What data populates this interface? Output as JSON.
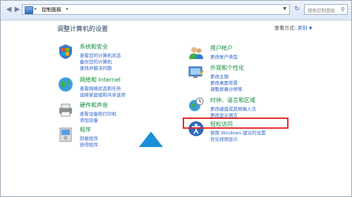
{
  "address_bar": {
    "crumb": "控制面板",
    "search_placeholder": "搜索控制面板"
  },
  "page_title": "调整计算机的设置",
  "view_by": {
    "label": "查看方式:",
    "value": "类别"
  },
  "categories_left": [
    {
      "title": "系统和安全",
      "links": [
        "查看您的计算机状态",
        "备份您的计算机",
        "查找并解决问题"
      ],
      "icon": "shield-flag-icon"
    },
    {
      "title": "网络和 Internet",
      "links": [
        "查看网络状态和任务",
        "选择家庭组和共享选项"
      ],
      "icon": "globe-network-icon"
    },
    {
      "title": "硬件和声音",
      "links": [
        "查看设备和打印机",
        "添加设备"
      ],
      "icon": "printer-icon"
    },
    {
      "title": "程序",
      "links": [
        "卸载程序",
        "获得程序"
      ],
      "icon": "programs-icon"
    }
  ],
  "categories_right": [
    {
      "title": "用户帐户",
      "links": [
        "更改帐户类型"
      ],
      "icon": "users-icon"
    },
    {
      "title": "外观和个性化",
      "links": [
        "更改主题",
        "更改桌面背景",
        "调整屏幕分辨率"
      ],
      "icon": "appearance-icon"
    },
    {
      "title": "时钟、语言和区域",
      "links": [
        "更改键盘或其他输入法",
        "更改显示语言"
      ],
      "icon": "clock-globe-icon"
    },
    {
      "title": "轻松访问",
      "links": [
        "使用 Windows 建议的设置",
        "优化视频显示"
      ],
      "icon": "ease-of-access-icon"
    }
  ],
  "colors": {
    "category_title": "#0e8a3a",
    "link": "#2a62c9",
    "highlight": "#e02424",
    "pointer": "#1a8fd6"
  }
}
